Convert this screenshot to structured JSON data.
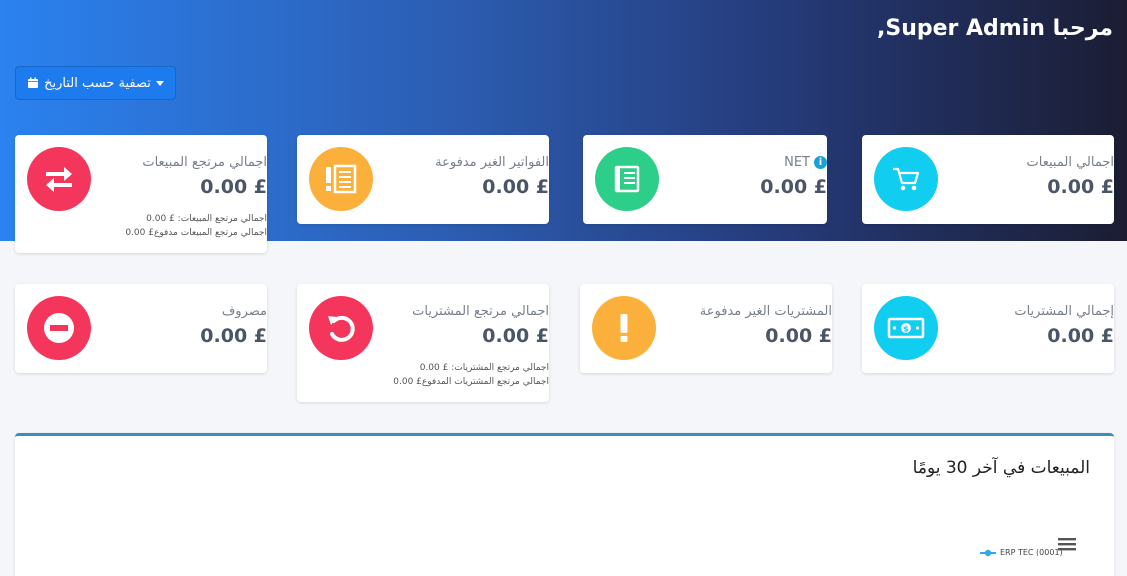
{
  "header": {
    "welcome": "مرحبا Super Admin,",
    "filter_label": "تصفية حسب التاريخ"
  },
  "row1": [
    {
      "label": "اجمالي مرتجع المبيعات",
      "value": "0.00 £",
      "icon": "exchange-icon",
      "color": "#f5365c",
      "sub": [
        "اجمالي مرتجع المبيعات: £ 0.00",
        "اجمالي مرتجع المبيعات مدفوع£ 0.00"
      ]
    },
    {
      "label": "الفواتير الغير مدفوعة",
      "value": "0.00 £",
      "icon": "invoice-alert-icon",
      "color": "#fbb03b"
    },
    {
      "label": "NET",
      "value": "0.00 £",
      "icon": "ledger-icon",
      "color": "#2dce89"
    },
    {
      "label": "اجمالي المبيعات",
      "value": "0.00 £",
      "icon": "cart-icon",
      "color": "#11cdef"
    }
  ],
  "row2": [
    {
      "label": "مصروف",
      "value": "0.00 £",
      "icon": "minus-circle-icon",
      "color": "#f5365c"
    },
    {
      "label": "اجمالي مرتجع المشتريات",
      "value": "0.00 £",
      "icon": "undo-icon",
      "color": "#f5365c",
      "sub": [
        "اجمالي مرتجع المشتريات: £ 0.00",
        "اجمالي مرتجع المشتريات المدفوع£ 0.00"
      ]
    },
    {
      "label": "المشتريات الغير مدفوعة",
      "value": "0.00 £",
      "icon": "exclamation-icon",
      "color": "#fbb03b"
    },
    {
      "label": "إجمالي المشتريات",
      "value": "0.00 £",
      "icon": "money-bill-icon",
      "color": "#11cdef"
    }
  ],
  "chart": {
    "title": "المبيعات في آخر 30 يومًا",
    "legend": "ERP TEC (0001)"
  },
  "chart_data": {
    "type": "line",
    "title": "المبيعات في آخر 30 يومًا",
    "series": [
      {
        "name": "ERP TEC (0001)",
        "values": []
      }
    ]
  }
}
